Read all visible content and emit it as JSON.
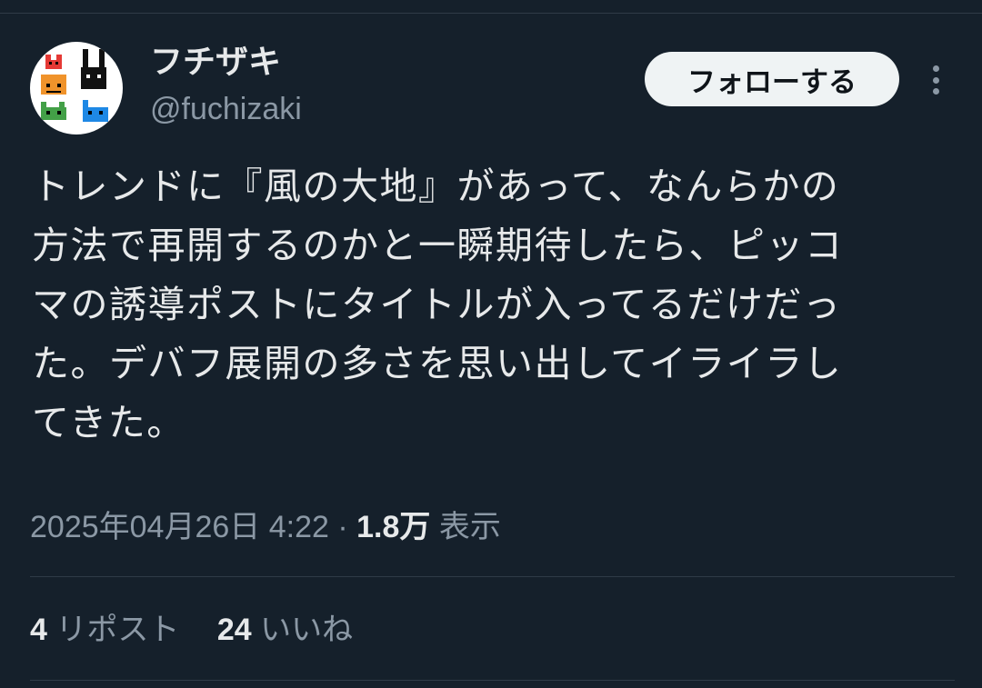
{
  "author": {
    "display_name": "フチザキ",
    "handle": "@fuchizaki",
    "avatar_icon": "pixel-characters-avatar"
  },
  "actions": {
    "follow_label": "フォローする",
    "more_icon": "more-vertical-icon"
  },
  "tweet": {
    "lines": [
      "トレンドに『風の大地』があって、なんらかの",
      "方法で再開するのかと一瞬期待したら、ピッコ",
      "マの誘導ポストにタイトルが入ってるだけだっ",
      "た。デバフ展開の多さを思い出してイライラし",
      "てきた。"
    ]
  },
  "meta": {
    "timestamp": "2025年04月26日 4:22",
    "separator": "·",
    "views_count": "1.8万",
    "views_label": "表示"
  },
  "stats": {
    "reposts_count": "4",
    "reposts_label": "リポスト",
    "likes_count": "24",
    "likes_label": "いいね"
  },
  "colors": {
    "background": "#15202b",
    "text": "#e7e9ea",
    "muted": "#8b98a5",
    "divider": "#2f3b47",
    "button_bg": "#eff3f4"
  }
}
